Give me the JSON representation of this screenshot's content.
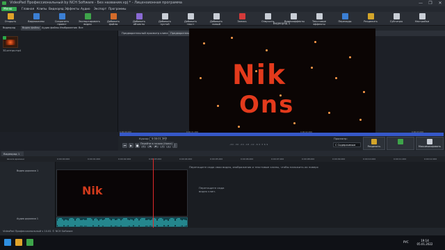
{
  "window": {
    "title": "VideoPad Профессиональный by NCH Software - Без названия.vpj * - Лицензионная программа",
    "controls": [
      "—",
      "❐",
      "✕"
    ]
  },
  "menubar": {
    "menu_button": "Меню",
    "items": [
      "Главная",
      "Клипы",
      "Видеоряд",
      "Эффекты",
      "Аудио",
      "Экспорт",
      "Программы"
    ]
  },
  "toolbar": {
    "buttons": [
      {
        "label": "Открыть",
        "icon": "open-icon",
        "color": "#e0a32a"
      },
      {
        "label": "Видеоклипы",
        "icon": "video-clips-icon",
        "color": "#3b7fd4"
      },
      {
        "label": "Сохранить проект",
        "icon": "save-icon",
        "color": "#3b7fd4"
      },
      {
        "label": "Экспортировать видео",
        "icon": "export-icon",
        "color": "#3ea44a"
      },
      {
        "label": "Добавить файлы",
        "icon": "add-files-icon",
        "color": "#d46b2a"
      },
      {
        "label": "Добавить объекты",
        "icon": "add-objects-icon",
        "color": "#8a6ad4"
      },
      {
        "label": "Добавить пустой",
        "icon": "add-blank-icon",
        "color": "#c9ced6"
      },
      {
        "label": "Добавить текст",
        "icon": "add-text-icon",
        "color": "#c9ced6"
      },
      {
        "label": "Добавить новый",
        "icon": "add-new-icon",
        "color": "#c9ced6"
      },
      {
        "label": "Запись",
        "icon": "record-icon",
        "color": "#d43a3a"
      },
      {
        "label": "Озвучить",
        "icon": "narrate-icon",
        "color": "#c9ced6"
      },
      {
        "label": "Видеоэффекты",
        "icon": "video-effects-icon",
        "color": "#c9ced6"
      },
      {
        "label": "Текстовые эффекты",
        "icon": "text-effects-icon",
        "color": "#c9ced6"
      },
      {
        "label": "Переходы",
        "icon": "transitions-icon",
        "color": "#3b7fd4"
      },
      {
        "label": "Разделить",
        "icon": "split-icon",
        "color": "#d4a52a"
      },
      {
        "label": "Субтитры",
        "icon": "subtitles-icon",
        "color": "#c9ced6"
      },
      {
        "label": "Настройки",
        "icon": "settings-icon",
        "color": "#c9ced6"
      }
    ]
  },
  "bin_tabs": [
    "Видеоряд",
    "Видео файлы",
    "Аудио файлы",
    "Изображения",
    "Все"
  ],
  "bin": {
    "item_name": "3D-интро.mp4"
  },
  "clip_tabs": [
    "Предварительный просмотр клипа",
    "Предварительный просмотр видеоряда"
  ],
  "viewer": {
    "title": "Видеоряд 1",
    "word1": "Nik",
    "word2": "Ons",
    "ruler_ticks": [
      "0:00:00.000",
      "0:00:01.000",
      "0:00:02.000",
      "0:00:03.000"
    ]
  },
  "player": {
    "position_label": "Курсор:",
    "position_value": "0:00:01.397",
    "jump_placeholder": "Перейти в начало (Home)",
    "zoom_ticks": "-40 -30 -24 -18 -12 -6 0 3 6 9",
    "preview_label": "Просмотр:",
    "preview_mode": "С Содержимым",
    "split_label": "Разделить",
    "stabilize_label": "",
    "fullscreen_label": "Максимизировать"
  },
  "sequence": {
    "tab_label": "Видеоряд 1",
    "ruler_label": "Шкала времени",
    "ticks": [
      "0:00:00.000",
      "0:00:01.000",
      "0:00:02.000",
      "0:00:03.000",
      "0:00:04.000",
      "0:00:05.000",
      "0:00:06.000",
      "0:00:07.000",
      "0:00:08.000",
      "0:00:09.000",
      "0:00:10.000",
      "0:00:11.000",
      "0:00:12.000"
    ],
    "video_track_name": "Видео дорожка 1",
    "audio_track_name": "Аудио дорожка 1",
    "hint": "Перетащите сюда свои видео, изображения и текстовые клипы, чтобы наложить их поверх",
    "drop_hint": "Перетащите сюда видео клип.",
    "clip_word": "Nik"
  },
  "status": {
    "text": "VideoPad Профессиональный v 10.81 © NCH Software"
  },
  "taskbar": {
    "time": "19:14",
    "date": "05.01.2022",
    "lang": "РУС"
  }
}
